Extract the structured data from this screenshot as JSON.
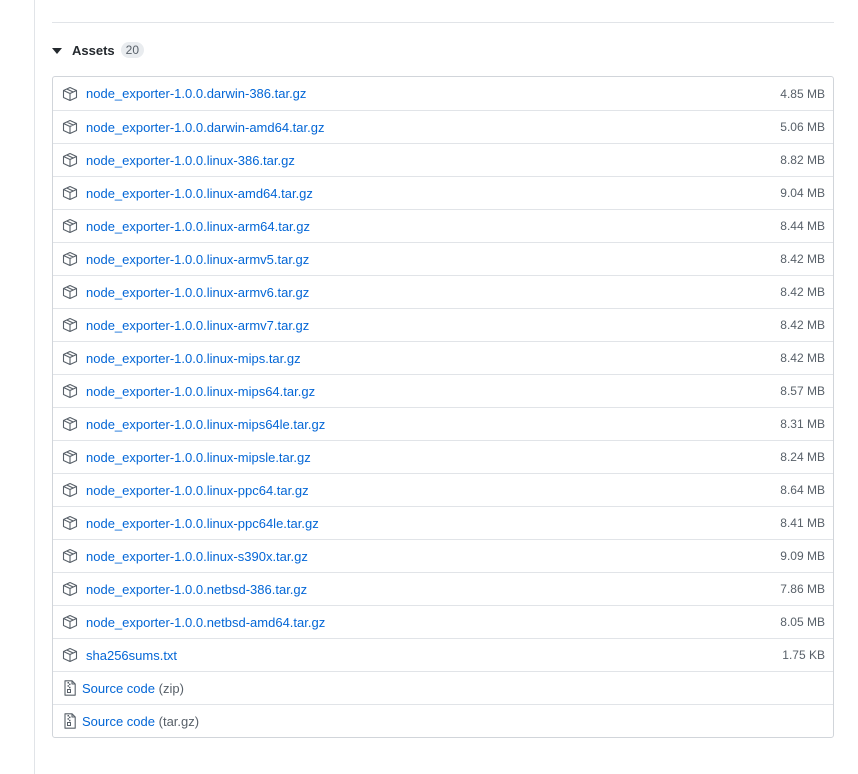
{
  "assets": {
    "title": "Assets",
    "count": "20",
    "files": [
      {
        "name": "node_exporter-1.0.0.darwin-386.tar.gz",
        "size": "4.85 MB"
      },
      {
        "name": "node_exporter-1.0.0.darwin-amd64.tar.gz",
        "size": "5.06 MB"
      },
      {
        "name": "node_exporter-1.0.0.linux-386.tar.gz",
        "size": "8.82 MB"
      },
      {
        "name": "node_exporter-1.0.0.linux-amd64.tar.gz",
        "size": "9.04 MB"
      },
      {
        "name": "node_exporter-1.0.0.linux-arm64.tar.gz",
        "size": "8.44 MB"
      },
      {
        "name": "node_exporter-1.0.0.linux-armv5.tar.gz",
        "size": "8.42 MB"
      },
      {
        "name": "node_exporter-1.0.0.linux-armv6.tar.gz",
        "size": "8.42 MB"
      },
      {
        "name": "node_exporter-1.0.0.linux-armv7.tar.gz",
        "size": "8.42 MB"
      },
      {
        "name": "node_exporter-1.0.0.linux-mips.tar.gz",
        "size": "8.42 MB"
      },
      {
        "name": "node_exporter-1.0.0.linux-mips64.tar.gz",
        "size": "8.57 MB"
      },
      {
        "name": "node_exporter-1.0.0.linux-mips64le.tar.gz",
        "size": "8.31 MB"
      },
      {
        "name": "node_exporter-1.0.0.linux-mipsle.tar.gz",
        "size": "8.24 MB"
      },
      {
        "name": "node_exporter-1.0.0.linux-ppc64.tar.gz",
        "size": "8.64 MB"
      },
      {
        "name": "node_exporter-1.0.0.linux-ppc64le.tar.gz",
        "size": "8.41 MB"
      },
      {
        "name": "node_exporter-1.0.0.linux-s390x.tar.gz",
        "size": "9.09 MB"
      },
      {
        "name": "node_exporter-1.0.0.netbsd-386.tar.gz",
        "size": "7.86 MB"
      },
      {
        "name": "node_exporter-1.0.0.netbsd-amd64.tar.gz",
        "size": "8.05 MB"
      },
      {
        "name": "sha256sums.txt",
        "size": "1.75 KB"
      }
    ],
    "source": [
      {
        "label": "Source code",
        "format": "(zip)"
      },
      {
        "label": "Source code",
        "format": "(tar.gz)"
      }
    ]
  },
  "icons": {
    "package": "package-icon",
    "file_zip": "file-zip-icon",
    "caret": "triangle-down-icon"
  },
  "colors": {
    "link": "#0366d6",
    "muted": "#586069",
    "border": "#d1d5da",
    "divider": "#e1e4e8"
  }
}
